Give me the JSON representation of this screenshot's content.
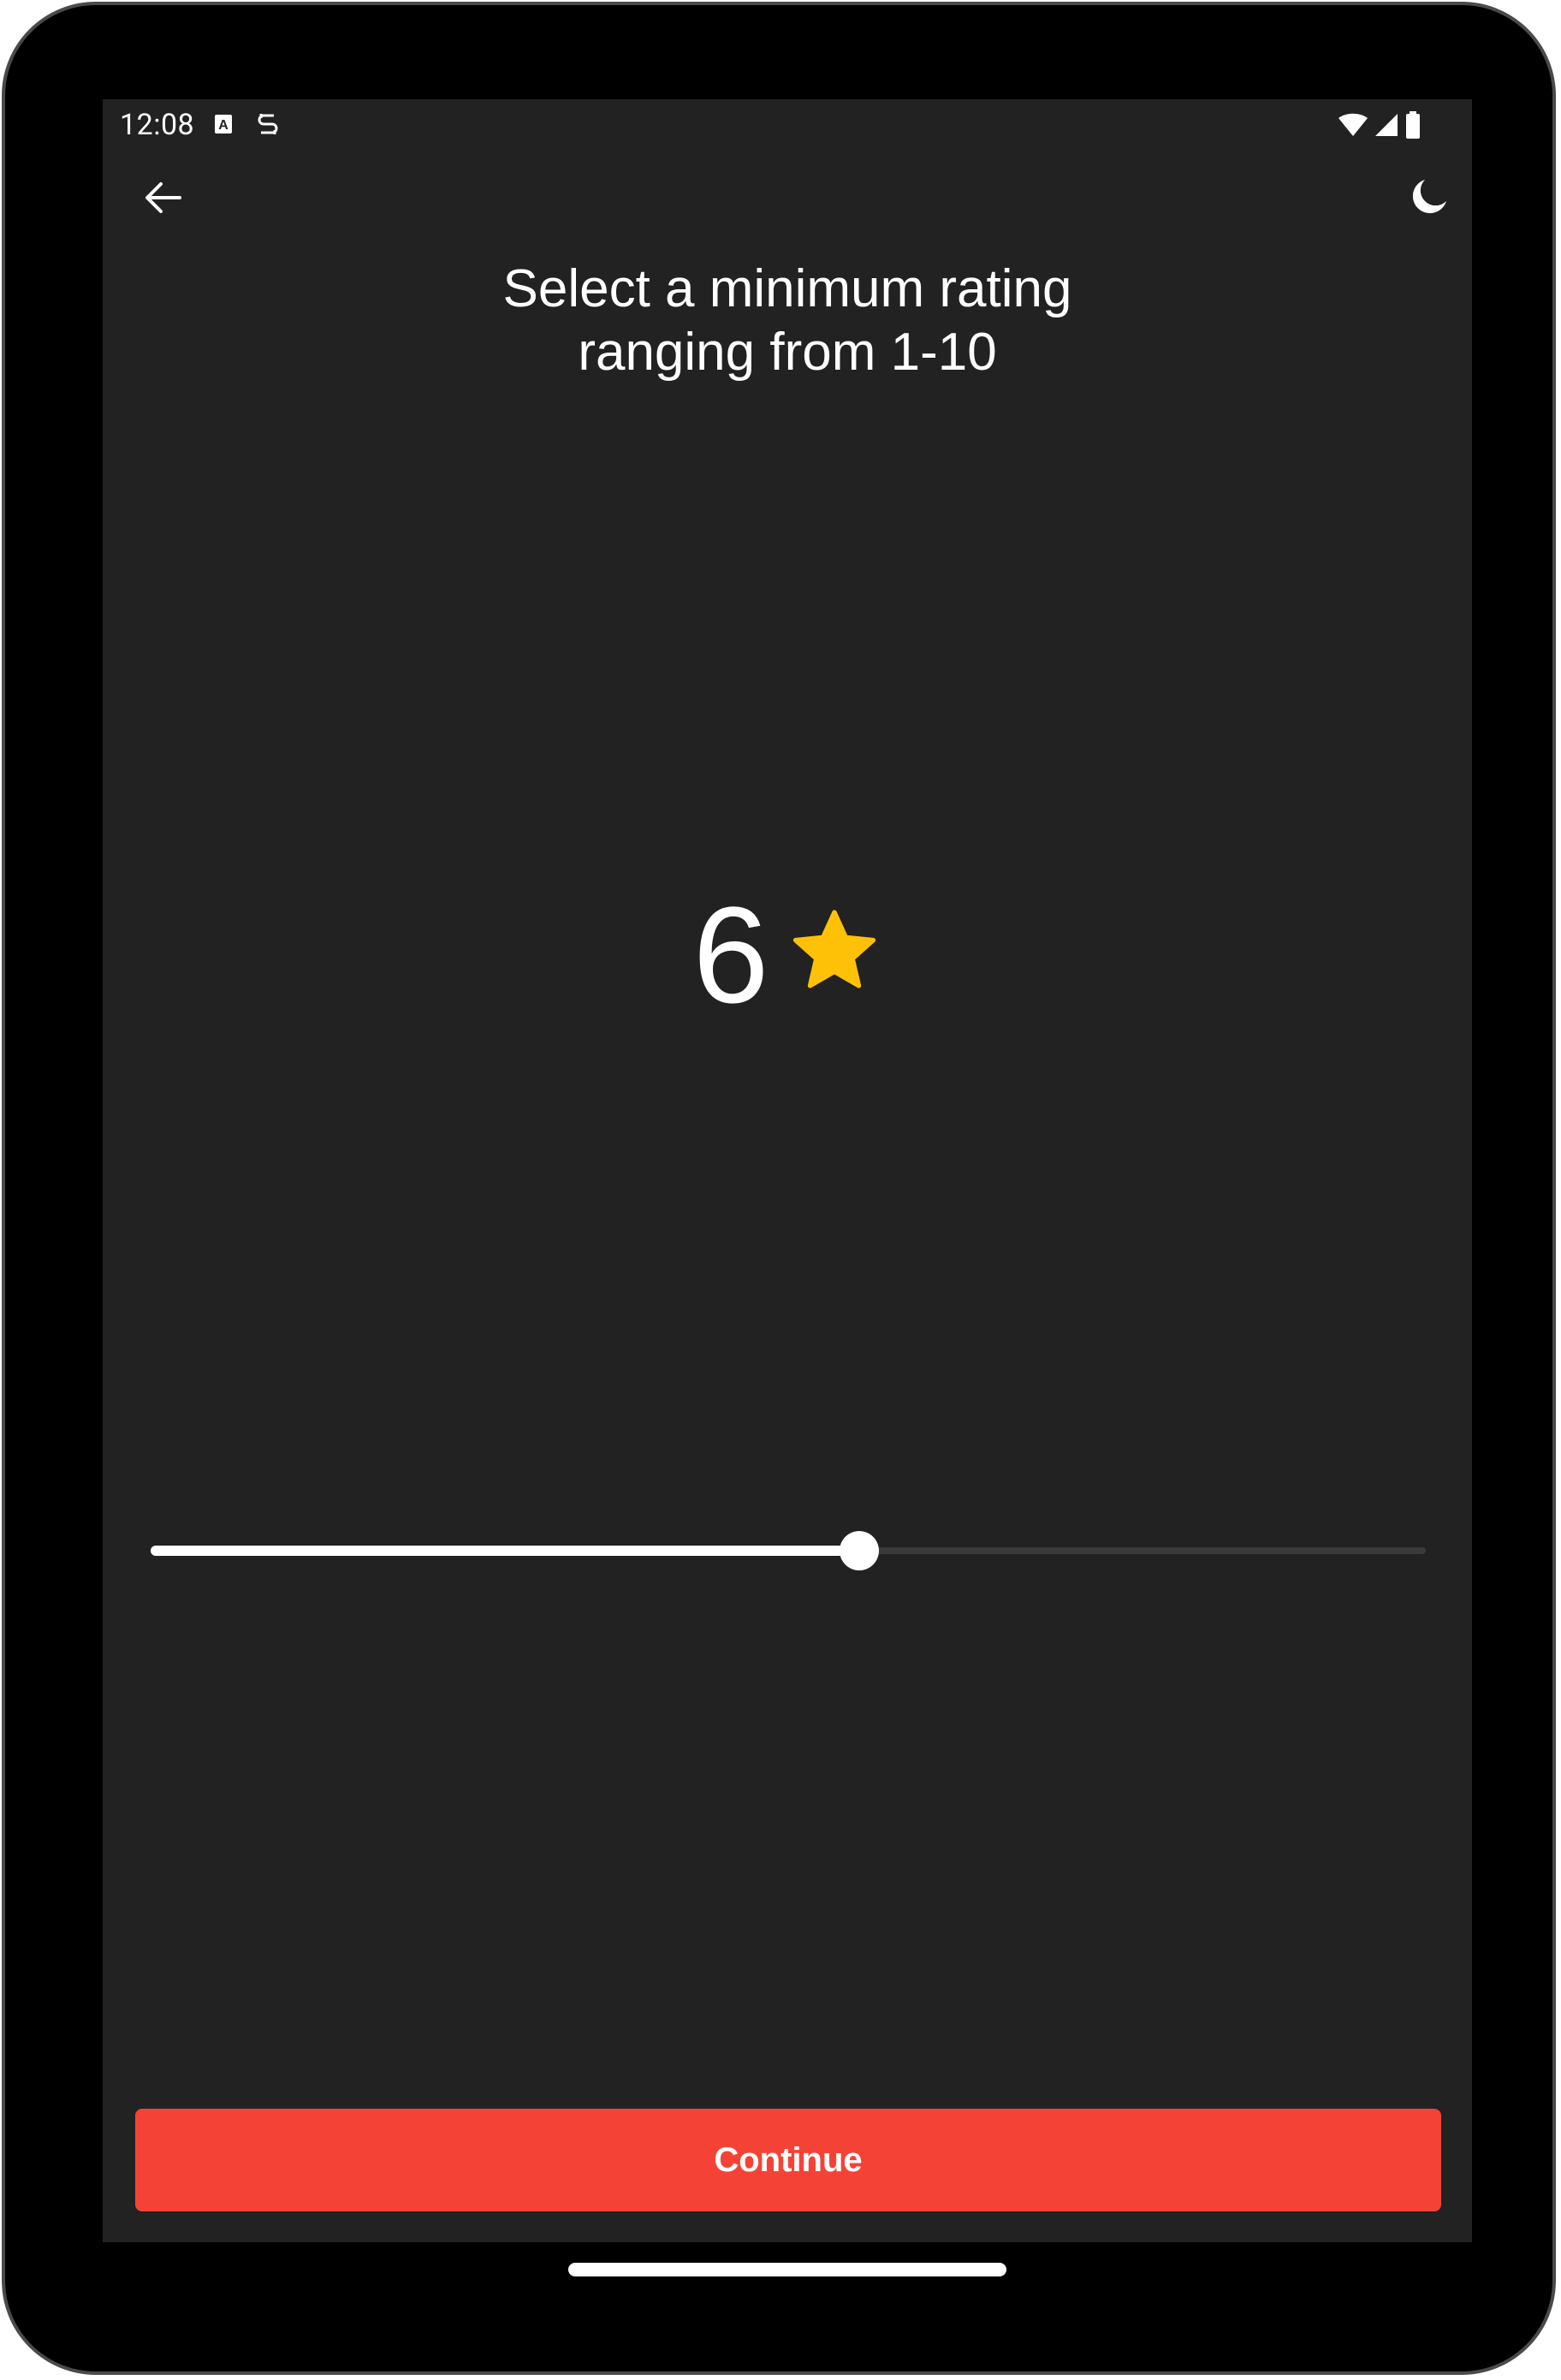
{
  "status_bar": {
    "time": "12:08",
    "icons": [
      "keyboard-a-icon",
      "sync-s-icon",
      "wifi-icon",
      "signal-icon",
      "battery-icon"
    ]
  },
  "top_bar": {
    "back_icon": "arrow-left-icon",
    "theme_icon": "moon-icon"
  },
  "title": "Select a minimum rating\nranging from 1-10",
  "rating": {
    "value": "6",
    "icon": "star-icon",
    "star_color": "#FFC107"
  },
  "slider": {
    "min": 1,
    "max": 10,
    "value": 6
  },
  "continue_label": "Continue",
  "colors": {
    "background": "#222222",
    "accent": "#F44336",
    "text": "#FFFFFF"
  }
}
